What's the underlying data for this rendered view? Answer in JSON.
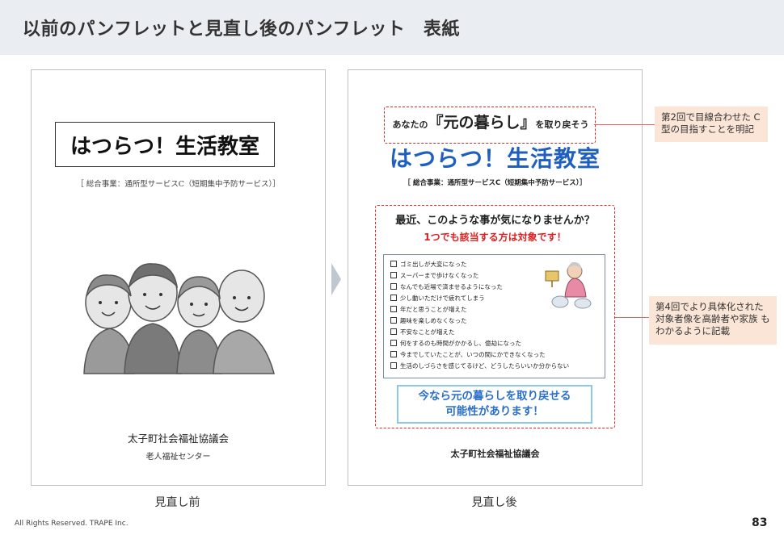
{
  "slide_title": "以前のパンフレットと見直し後のパンフレット　表紙",
  "before": {
    "caption": "見直し前",
    "title": "はつらつ！生活教室",
    "subtitle": "［ 総合事業：通所型サービスC（短期集中予防サービス）］",
    "org": "太子町社会福祉協議会",
    "org_sub": "老人福祉センター",
    "illustration": "elderly-group-illustration"
  },
  "after": {
    "caption": "見直し後",
    "tagline_pre": "あなたの",
    "tagline_main": "『元の暮らし』",
    "tagline_post": "を取り戻そう",
    "title": "はつらつ！生活教室",
    "subtitle": "［ 総合事業：通所型サービスC（短期集中予防サービス）］",
    "question": "最近、このような事が気になりませんか？",
    "target_line": "1つでも該当する方は対象です！",
    "checklist": [
      "ゴミ出しが大変になった",
      "スーパーまで歩けなくなった",
      "なんでも近場で済ませるようになった",
      "少し動いただけで疲れてしまう",
      "年だと思うことが増えた",
      "趣味を楽しめなくなった",
      "不安なことが増えた",
      "何をするのも時間がかかるし、億劫になった",
      "今までしていたことが、いつの間にかできなくなった",
      "生活のしづらさを感じてるけど、どうしたらいいか分からない"
    ],
    "appeal_line1": "今なら元の暮らしを取り戻せる",
    "appeal_line2": "可能性があります！",
    "org": "太子町社会福祉協議会"
  },
  "notes": {
    "note1": "第2回で目線合わせた C型の目指すことを明記",
    "note2": "第4回でより具体化された 対象者像を高齢者や家族 もわかるように記載"
  },
  "footer": {
    "copyright": "All Rights Reserved. TRAPE Inc.",
    "page_number": "83"
  },
  "colors": {
    "header_bg": "#eaeef3",
    "accent_red": "#d52b2b",
    "title_blue": "#1f5fbf",
    "note_bg": "#fbe5d6"
  }
}
